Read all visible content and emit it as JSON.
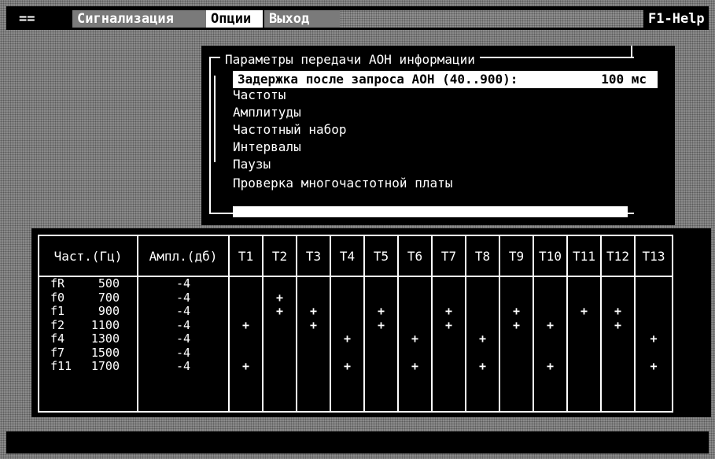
{
  "menu": {
    "system": "==",
    "signaling": "Сигнализация",
    "options": "Опции",
    "exit": "Выход",
    "help": "F1-Help"
  },
  "dialog": {
    "title": "Параметры передачи АОН информации",
    "items": [
      {
        "label": "Задержка после запроса АОН (40..900):",
        "value": "100 мс",
        "selected": true
      },
      {
        "label": "Частоты"
      },
      {
        "label": "Амплитуды"
      },
      {
        "label": "Частотный набор"
      },
      {
        "label": "Интервалы"
      },
      {
        "label": "Паузы"
      },
      {
        "label": "Проверка многочастотной платы"
      }
    ]
  },
  "table": {
    "headers": [
      "Част.(Гц)",
      "Ампл.(дб)",
      "T1",
      "T2",
      "T3",
      "T4",
      "T5",
      "T6",
      "T7",
      "T8",
      "T9",
      "T10",
      "T11",
      "T12",
      "T13"
    ],
    "rows": [
      {
        "name": "fR",
        "freq": "500",
        "amp": "-4",
        "marks": [
          0,
          0,
          0,
          0,
          0,
          0,
          0,
          0,
          0,
          0,
          0,
          0,
          0
        ]
      },
      {
        "name": "f0",
        "freq": "700",
        "amp": "-4",
        "marks": [
          0,
          1,
          0,
          0,
          0,
          0,
          0,
          0,
          0,
          0,
          0,
          0,
          0
        ]
      },
      {
        "name": "f1",
        "freq": "900",
        "amp": "-4",
        "marks": [
          0,
          1,
          1,
          0,
          1,
          0,
          1,
          0,
          1,
          0,
          1,
          1,
          0
        ]
      },
      {
        "name": "f2",
        "freq": "1100",
        "amp": "-4",
        "marks": [
          1,
          0,
          1,
          0,
          1,
          0,
          1,
          0,
          1,
          1,
          0,
          1,
          0
        ]
      },
      {
        "name": "f4",
        "freq": "1300",
        "amp": "-4",
        "marks": [
          0,
          0,
          0,
          1,
          0,
          1,
          0,
          1,
          0,
          0,
          0,
          0,
          1
        ]
      },
      {
        "name": "f7",
        "freq": "1500",
        "amp": "-4",
        "marks": [
          0,
          0,
          0,
          0,
          0,
          0,
          0,
          0,
          0,
          0,
          0,
          0,
          0
        ]
      },
      {
        "name": "f11",
        "freq": "1700",
        "amp": "-4",
        "marks": [
          1,
          0,
          0,
          1,
          0,
          1,
          0,
          1,
          0,
          1,
          0,
          0,
          1
        ]
      }
    ],
    "mark_symbol": "+"
  }
}
